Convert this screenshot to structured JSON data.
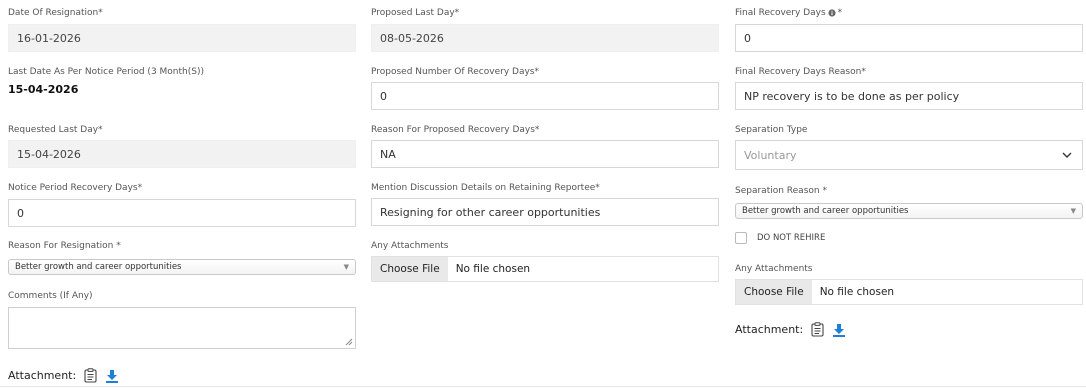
{
  "col1": {
    "date_of_resignation": {
      "label": "Date Of Resignation*",
      "value": "16-01-2026"
    },
    "last_date_notice": {
      "label": "Last Date As Per Notice Period (3 Month(S))",
      "value": "15-04-2026"
    },
    "requested_last_day": {
      "label": "Requested Last Day*",
      "value": "15-04-2026"
    },
    "notice_recovery_days": {
      "label": "Notice Period Recovery Days*",
      "value": "0"
    },
    "reason_for_resignation": {
      "label": "Reason For Resignation *",
      "value": "Better growth and career opportunities"
    },
    "comments": {
      "label": "Comments (If Any)",
      "value": ""
    },
    "attachment_label": "Attachment:"
  },
  "col2": {
    "proposed_last_day": {
      "label": "Proposed Last Day*",
      "value": "08-05-2026"
    },
    "proposed_recovery_days": {
      "label": "Proposed Number Of Recovery Days*",
      "value": "0"
    },
    "reason_proposed_recovery": {
      "label": "Reason For Proposed Recovery Days*",
      "value": "NA"
    },
    "discussion_details": {
      "label": "Mention Discussion Details on Retaining Reportee*",
      "value": "Resigning for other career opportunities"
    },
    "attachments": {
      "label": "Any Attachments",
      "button": "Choose File",
      "status": "No file chosen"
    }
  },
  "col3": {
    "final_recovery_days": {
      "label": "Final Recovery Days",
      "suffix": "*",
      "value": "0"
    },
    "final_recovery_reason": {
      "label": "Final Recovery Days Reason*",
      "value": "NP recovery is to be done as per policy"
    },
    "separation_type": {
      "label": "Separation Type",
      "value": "Voluntary"
    },
    "separation_reason": {
      "label": "Separation Reason *",
      "value": "Better growth and career opportunities"
    },
    "do_not_rehire": {
      "label": "DO NOT REHIRE",
      "checked": false
    },
    "attachments": {
      "label": "Any Attachments",
      "button": "Choose File",
      "status": "No file chosen"
    },
    "attachment_label": "Attachment:"
  },
  "icons": {
    "info": "info-circle-icon",
    "clipboard": "clipboard-icon",
    "download": "download-icon",
    "chevron": "chevron-down-icon",
    "caret": "caret-down-icon"
  },
  "colors": {
    "download_blue": "#1e7fd8",
    "readonly_bg": "#f2f2f2"
  }
}
